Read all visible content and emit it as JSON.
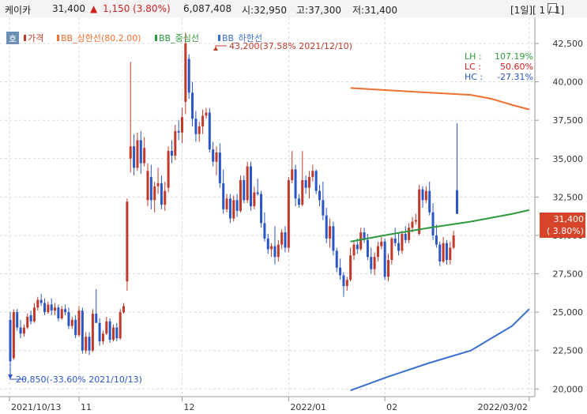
{
  "header": {
    "stock_name": "케이카",
    "price": "31,400",
    "change_arrow": "▲",
    "change": "1,150 (3.80%)",
    "volume": "6,087,408",
    "open": "시:32,950",
    "high": "고:37,300",
    "low": "저:31,400",
    "page_info": "[1일][ 1 / 1]"
  },
  "legend": {
    "badge": "호",
    "items": [
      {
        "label": "가격",
        "color": "#c0392b"
      },
      {
        "label": "BB_상한선(80,2.00)",
        "color": "#f07030"
      },
      {
        "label": "BB_중심선",
        "color": "#2e9a3c"
      },
      {
        "label": "BB_하한선",
        "color": "#3a6fd0"
      }
    ]
  },
  "stats": {
    "lh_label": "LH :",
    "lh_value": "107.19%",
    "lc_label": "LC :",
    "lc_value": "50.60%",
    "hc_label": "HC :",
    "hc_value": "-27.31%"
  },
  "annotations": {
    "high": "43,200(37.58% 2021/12/10)",
    "low": "20,850(-33.60% 2021/10/13)"
  },
  "price_tag": {
    "value": "31,400",
    "pct": "( 3.80%)"
  },
  "colors": {
    "up": "#c0392b",
    "down": "#2a56c6",
    "upper_band": "#f07030",
    "mid_band": "#2e9a3c",
    "lower_band": "#3a6fd0",
    "tag_bg": "#d6452a"
  },
  "chart_data": {
    "type": "candlestick",
    "y_ticks": [
      "20,000",
      "22,500",
      "25,000",
      "27,500",
      "30,000",
      "32,500",
      "35,000",
      "37,500",
      "40,000",
      "42,500"
    ],
    "x_labels": [
      "2021/10/13",
      "11",
      "12",
      "2022/01",
      "02",
      "2022/03/02"
    ],
    "ylim": [
      19500,
      44200
    ],
    "candles": [
      [
        24500,
        25000,
        20850,
        21800
      ],
      [
        22000,
        25200,
        21900,
        25000
      ],
      [
        25000,
        25200,
        23800,
        24000
      ],
      [
        24000,
        24500,
        23300,
        23600
      ],
      [
        23600,
        24200,
        23400,
        24000
      ],
      [
        24000,
        24900,
        23900,
        24700
      ],
      [
        24800,
        25100,
        24200,
        24400
      ],
      [
        24400,
        25600,
        24300,
        25300
      ],
      [
        25300,
        26000,
        25100,
        25800
      ],
      [
        25800,
        26200,
        25400,
        25600
      ],
      [
        25600,
        25900,
        24800,
        25000
      ],
      [
        25000,
        25700,
        24900,
        25500
      ],
      [
        25500,
        25900,
        24800,
        25100
      ],
      [
        25100,
        25600,
        24800,
        25300
      ],
      [
        25300,
        25500,
        24400,
        24600
      ],
      [
        24600,
        25400,
        24500,
        25200
      ],
      [
        25200,
        25500,
        24800,
        25000
      ],
      [
        25000,
        25300,
        23900,
        24100
      ],
      [
        24100,
        24700,
        23900,
        24500
      ],
      [
        24500,
        24800,
        23300,
        23500
      ],
      [
        23500,
        25400,
        23400,
        25100
      ],
      [
        25100,
        25300,
        22300,
        22500
      ],
      [
        22500,
        23700,
        22300,
        23400
      ],
      [
        23400,
        23700,
        22200,
        22500
      ],
      [
        22500,
        25200,
        22400,
        24900
      ],
      [
        24900,
        26500,
        24700,
        24300
      ],
      [
        24300,
        24600,
        22800,
        23100
      ],
      [
        23100,
        23800,
        22900,
        23600
      ],
      [
        23600,
        24700,
        23500,
        24400
      ],
      [
        24400,
        24600,
        23000,
        23200
      ],
      [
        23200,
        24200,
        23100,
        24000
      ],
      [
        24000,
        24300,
        23100,
        23300
      ],
      [
        23300,
        25200,
        23200,
        25000
      ],
      [
        25000,
        25600,
        24900,
        25400
      ],
      [
        27000,
        32400,
        26400,
        32200
      ],
      [
        35000,
        41300,
        34100,
        35800
      ],
      [
        35800,
        36600,
        33900,
        34400
      ],
      [
        34400,
        36700,
        34200,
        36200
      ],
      [
        36200,
        36800,
        34000,
        34700
      ],
      [
        34700,
        36400,
        34500,
        35700
      ],
      [
        32300,
        34700,
        31900,
        34200
      ],
      [
        33800,
        34600,
        31700,
        32300
      ],
      [
        32300,
        33500,
        31500,
        33200
      ],
      [
        33200,
        34400,
        32700,
        33400
      ],
      [
        33400,
        33900,
        31700,
        32000
      ],
      [
        32000,
        33500,
        31600,
        32900
      ],
      [
        33100,
        35800,
        32800,
        35500
      ],
      [
        35500,
        36200,
        34700,
        35200
      ],
      [
        35200,
        37200,
        34900,
        36800
      ],
      [
        36800,
        37500,
        36200,
        36700
      ],
      [
        36700,
        38300,
        36000,
        37700
      ],
      [
        38700,
        43200,
        37900,
        42500
      ],
      [
        41500,
        41800,
        38900,
        39300
      ],
      [
        39300,
        40000,
        37100,
        37600
      ],
      [
        37600,
        38100,
        36100,
        36600
      ],
      [
        36600,
        37400,
        36100,
        37100
      ],
      [
        37100,
        38200,
        36600,
        37800
      ],
      [
        37800,
        38300,
        37600,
        38000
      ],
      [
        38000,
        38300,
        35400,
        35600
      ],
      [
        35600,
        36100,
        34500,
        34800
      ],
      [
        34800,
        35800,
        33900,
        35400
      ],
      [
        35400,
        36000,
        33100,
        33400
      ],
      [
        33400,
        34300,
        31400,
        31700
      ],
      [
        31700,
        32700,
        31500,
        32400
      ],
      [
        32400,
        32700,
        30800,
        31100
      ],
      [
        31100,
        32600,
        30900,
        32300
      ],
      [
        32300,
        32700,
        31200,
        31600
      ],
      [
        31600,
        33900,
        31500,
        33600
      ],
      [
        33600,
        33900,
        32100,
        32300
      ],
      [
        32300,
        34800,
        32100,
        34500
      ],
      [
        34500,
        34800,
        31600,
        31900
      ],
      [
        31900,
        33200,
        31700,
        32800
      ],
      [
        32800,
        33700,
        32600,
        32700
      ],
      [
        32700,
        32900,
        30500,
        30800
      ],
      [
        30800,
        31500,
        29600,
        29800
      ],
      [
        29800,
        30100,
        28800,
        29100
      ],
      [
        29100,
        29500,
        28600,
        29300
      ],
      [
        29300,
        30600,
        28100,
        28600
      ],
      [
        28600,
        29700,
        28300,
        29400
      ],
      [
        29400,
        30400,
        29100,
        30200
      ],
      [
        30200,
        30600,
        28900,
        29200
      ],
      [
        29200,
        33800,
        28900,
        33600
      ],
      [
        33600,
        35500,
        33400,
        34300
      ],
      [
        34300,
        34600,
        31900,
        32400
      ],
      [
        32400,
        32700,
        31800,
        32000
      ],
      [
        32000,
        35500,
        31900,
        33600
      ],
      [
        33600,
        33900,
        32700,
        33100
      ],
      [
        33100,
        34200,
        32400,
        33800
      ],
      [
        33800,
        34600,
        33500,
        34200
      ],
      [
        34200,
        34300,
        32700,
        32900
      ],
      [
        32900,
        33300,
        31900,
        32300
      ],
      [
        32300,
        33500,
        31000,
        31300
      ],
      [
        31300,
        31800,
        29500,
        29800
      ],
      [
        29800,
        31100,
        29200,
        30600
      ],
      [
        30600,
        30900,
        28700,
        29000
      ],
      [
        29000,
        29200,
        27600,
        27900
      ],
      [
        27900,
        28500,
        27100,
        27400
      ],
      [
        27400,
        27600,
        26000,
        26700
      ],
      [
        26700,
        27300,
        26400,
        27100
      ],
      [
        27100,
        29200,
        27000,
        28700
      ],
      [
        28700,
        29600,
        28400,
        29400
      ],
      [
        29400,
        29800,
        28800,
        29100
      ],
      [
        29100,
        30500,
        29000,
        30200
      ],
      [
        30200,
        30500,
        29500,
        29700
      ],
      [
        29700,
        30100,
        28400,
        28600
      ],
      [
        28600,
        29200,
        27500,
        27800
      ],
      [
        27800,
        28900,
        27400,
        28600
      ],
      [
        28600,
        29600,
        28300,
        29300
      ],
      [
        29300,
        29900,
        29100,
        29600
      ],
      [
        29600,
        29800,
        27100,
        27300
      ],
      [
        27300,
        28800,
        27000,
        28400
      ],
      [
        28400,
        29900,
        28100,
        29800
      ],
      [
        29800,
        30500,
        29300,
        29500
      ],
      [
        29500,
        30200,
        28700,
        29000
      ],
      [
        29000,
        30300,
        28800,
        30100
      ],
      [
        30100,
        30600,
        29500,
        29700
      ],
      [
        29700,
        30800,
        29500,
        30500
      ],
      [
        30500,
        31200,
        30200,
        30900
      ],
      [
        30900,
        31400,
        30700,
        31000
      ],
      [
        30100,
        33300,
        30000,
        33000
      ],
      [
        33000,
        33200,
        31800,
        32300
      ],
      [
        32300,
        33200,
        32100,
        32900
      ],
      [
        32900,
        33500,
        31300,
        31500
      ],
      [
        31500,
        32100,
        29700,
        30000
      ],
      [
        30000,
        30700,
        29200,
        29400
      ],
      [
        29400,
        29600,
        28000,
        28300
      ],
      [
        28300,
        29900,
        28200,
        29500
      ],
      [
        29500,
        29700,
        28100,
        28400
      ],
      [
        28400,
        29600,
        28100,
        29200
      ],
      [
        29200,
        30300,
        29100,
        30000
      ],
      [
        32950,
        37300,
        31400,
        31400
      ]
    ],
    "upper_band": [
      [
        99,
        39600
      ],
      [
        110,
        39450
      ],
      [
        122,
        39300
      ],
      [
        134,
        39150
      ],
      [
        140,
        38900
      ],
      [
        146,
        38500
      ],
      [
        151,
        38200
      ]
    ],
    "mid_band": [
      [
        99,
        29600
      ],
      [
        110,
        30050
      ],
      [
        122,
        30500
      ],
      [
        134,
        30900
      ],
      [
        140,
        31150
      ],
      [
        146,
        31400
      ],
      [
        151,
        31650
      ]
    ],
    "lower_band": [
      [
        99,
        19900
      ],
      [
        110,
        20800
      ],
      [
        122,
        21700
      ],
      [
        134,
        22500
      ],
      [
        140,
        23300
      ],
      [
        146,
        24100
      ],
      [
        151,
        25200
      ]
    ]
  }
}
